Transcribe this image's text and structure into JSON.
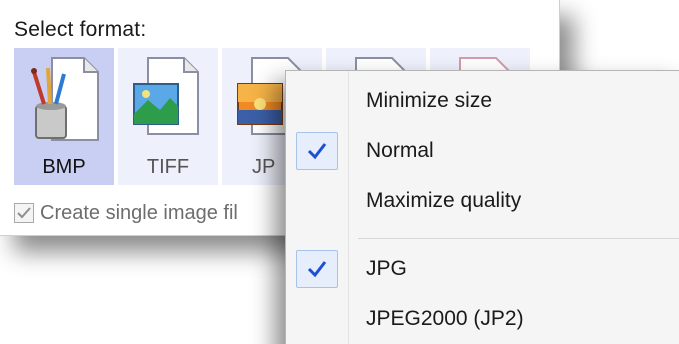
{
  "panel": {
    "title": "Select format:",
    "formats": [
      {
        "label": "BMP",
        "icon": "bmp-paint-icon",
        "selected": true
      },
      {
        "label": "TIFF",
        "icon": "tiff-landscape-icon",
        "selected": false
      },
      {
        "label": "JP",
        "icon": "jpg-sunset-icon",
        "selected": false
      },
      {
        "label": "",
        "icon": "document-icon",
        "selected": false
      },
      {
        "label": "",
        "icon": "pdf-document-icon",
        "selected": false
      }
    ],
    "single_image_checkbox": {
      "label": "Create single image fil",
      "checked": true
    }
  },
  "context_menu": {
    "quality_items": [
      {
        "label": "Minimize size",
        "checked": false
      },
      {
        "label": "Normal",
        "checked": true
      },
      {
        "label": "Maximize quality",
        "checked": false
      }
    ],
    "format_items": [
      {
        "label": "JPG",
        "checked": true
      },
      {
        "label": "JPEG2000 (JP2)",
        "checked": false
      }
    ]
  },
  "colors": {
    "selected_tile": "#c9cff2",
    "tile": "#eef0fb",
    "check_mark": "#1d4fd6",
    "check_frame": "#e6eefb"
  }
}
